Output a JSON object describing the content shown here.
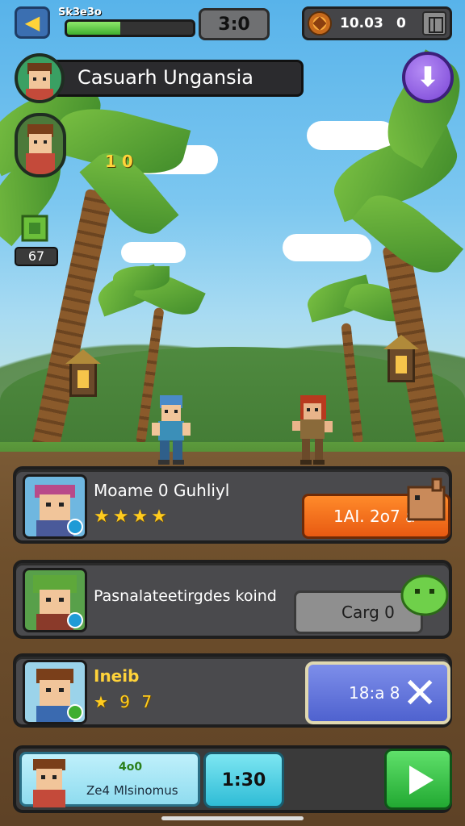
{
  "hud": {
    "xp_label": "Sk3e3o",
    "xp_progress": 0.42,
    "timer": "3:0",
    "coin_value": "10.03",
    "coin_count": "0"
  },
  "player": {
    "name": "Casuarh Ungansia",
    "level_tag": "1 0",
    "item_count": "67"
  },
  "cards": [
    {
      "title": "Moame 0 Guhliyl",
      "stars": "★★★★",
      "action_label": "1AI. 2o7 a"
    },
    {
      "title": "Pasnalateetirgdes koind",
      "action_label": "Carg 0"
    },
    {
      "title": "Ineib",
      "stats": "★ 9 7",
      "action_label": "18:a 8"
    }
  ],
  "bottom": {
    "line1": "4o0",
    "line2": "Ze4 Mlsinomus",
    "time": "1:30"
  },
  "icons": {
    "back": "arrow-left-icon",
    "download": "arrow-down-icon",
    "coin": "coin-icon",
    "map": "map-icon",
    "close": "close-icon",
    "play": "play-icon"
  }
}
